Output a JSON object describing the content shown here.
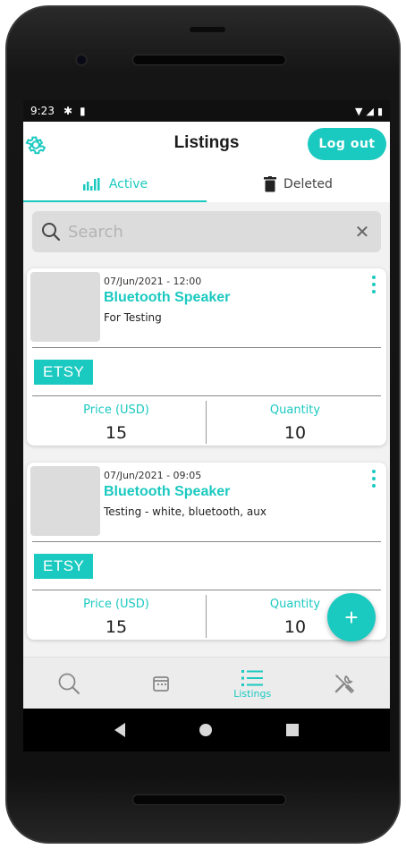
{
  "status_bar": {
    "time": "9:23",
    "icons": [
      "settings-gear-icon",
      "sd-card-icon"
    ],
    "right_icons": [
      "wifi-icon",
      "signal-icon",
      "battery-icon"
    ]
  },
  "header": {
    "title": "Listings",
    "logout_label": "Log out",
    "settings_icon": "gear-icon"
  },
  "tabs": [
    {
      "label": "Active",
      "icon": "bar-chart-icon",
      "active": true
    },
    {
      "label": "Deleted",
      "icon": "trash-icon",
      "active": false
    }
  ],
  "search": {
    "placeholder": "Search",
    "value": ""
  },
  "listings": [
    {
      "date": "07/Jun/2021 - 12:00",
      "title": "Bluetooth Speaker",
      "description": "For Testing",
      "channel": "ETSY",
      "price_label": "Price (USD)",
      "price": "15",
      "quantity_label": "Quantity",
      "quantity": "10"
    },
    {
      "date": "07/Jun/2021 - 09:05",
      "title": "Bluetooth Speaker",
      "description": "Testing - white, bluetooth, aux",
      "channel": "ETSY",
      "price_label": "Price (USD)",
      "price": "15",
      "quantity_label": "Quantity",
      "quantity": "10"
    }
  ],
  "fab": {
    "label": "+"
  },
  "bottom_nav": [
    {
      "icon": "search-icon",
      "label": "",
      "active": false
    },
    {
      "icon": "calendar-icon",
      "label": "",
      "active": false
    },
    {
      "icon": "list-icon",
      "label": "Listings",
      "active": true
    },
    {
      "icon": "tools-icon",
      "label": "",
      "active": false
    }
  ],
  "colors": {
    "accent": "#1ac9c0",
    "background": "#f2f2f2",
    "thumbnail": "#dcdcdc"
  }
}
